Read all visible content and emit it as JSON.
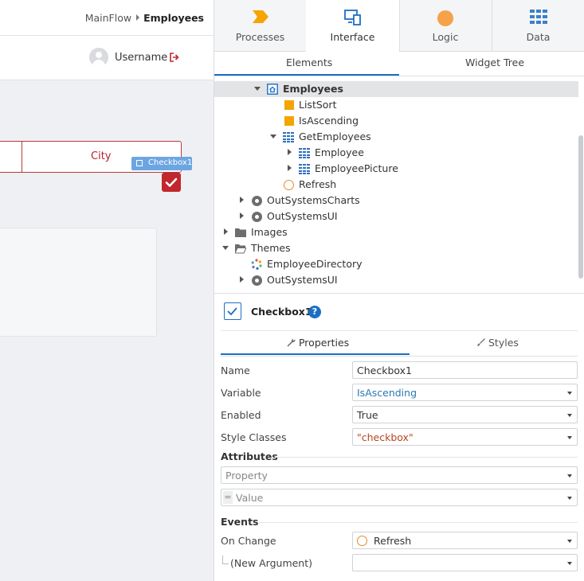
{
  "canvas": {
    "breadcrumb": {
      "flow": "MainFlow",
      "screen": "Employees"
    },
    "user": {
      "name": "Username"
    },
    "table": {
      "header_city": "City"
    },
    "selection_tag": "Checkbox1"
  },
  "panel": {
    "main_tabs": [
      {
        "label": "Processes",
        "icon": "processes-icon",
        "color": "#f5a400"
      },
      {
        "label": "Interface",
        "icon": "interface-icon",
        "color": "#1d6fc4"
      },
      {
        "label": "Logic",
        "icon": "logic-icon",
        "color": "#f5a24a"
      },
      {
        "label": "Data",
        "icon": "data-icon",
        "color": "#3b7fc9"
      }
    ],
    "sub_tabs": [
      "Elements",
      "Widget Tree"
    ],
    "tree": [
      {
        "label": "Employees",
        "icon": "screen-icon",
        "expand": "down",
        "selected": true
      },
      {
        "label": "ListSort",
        "icon": "local-variable-icon"
      },
      {
        "label": "IsAscending",
        "icon": "local-variable-icon"
      },
      {
        "label": "GetEmployees",
        "icon": "aggregate-icon",
        "expand": "down"
      },
      {
        "label": "Employee",
        "icon": "entity-icon",
        "expand": "right"
      },
      {
        "label": "EmployeePicture",
        "icon": "entity-icon",
        "expand": "right"
      },
      {
        "label": "Refresh",
        "icon": "screen-action-icon"
      },
      {
        "label": "OutSystemsCharts",
        "icon": "module-icon",
        "expand": "right"
      },
      {
        "label": "OutSystemsUI",
        "icon": "module-icon",
        "expand": "right"
      },
      {
        "label": "Images",
        "icon": "folder-icon",
        "expand": "right"
      },
      {
        "label": "Themes",
        "icon": "folder-open-icon",
        "expand": "down"
      },
      {
        "label": "EmployeeDirectory",
        "icon": "theme-icon"
      },
      {
        "label": "OutSystemsUI",
        "icon": "module-icon",
        "expand": "right"
      }
    ],
    "properties": {
      "object_name": "Checkbox1",
      "help": "?",
      "tabs": [
        "Properties",
        "Styles"
      ],
      "name_label": "Name",
      "name_value": "Checkbox1",
      "variable_label": "Variable",
      "variable_value": "IsAscending",
      "enabled_label": "Enabled",
      "enabled_value": "True",
      "style_label": "Style Classes",
      "style_value": "\"checkbox\"",
      "attributes_title": "Attributes",
      "attr_property_placeholder": "Property",
      "attr_value_placeholder": "Value",
      "attr_eq": "=",
      "events_title": "Events",
      "onchange_label": "On Change",
      "onchange_value": "Refresh",
      "new_argument_label": "(New Argument)"
    },
    "colors": {
      "accent": "#1d6fc4",
      "variable_text": "#2a7ab0",
      "string_text": "#b5461f"
    }
  }
}
